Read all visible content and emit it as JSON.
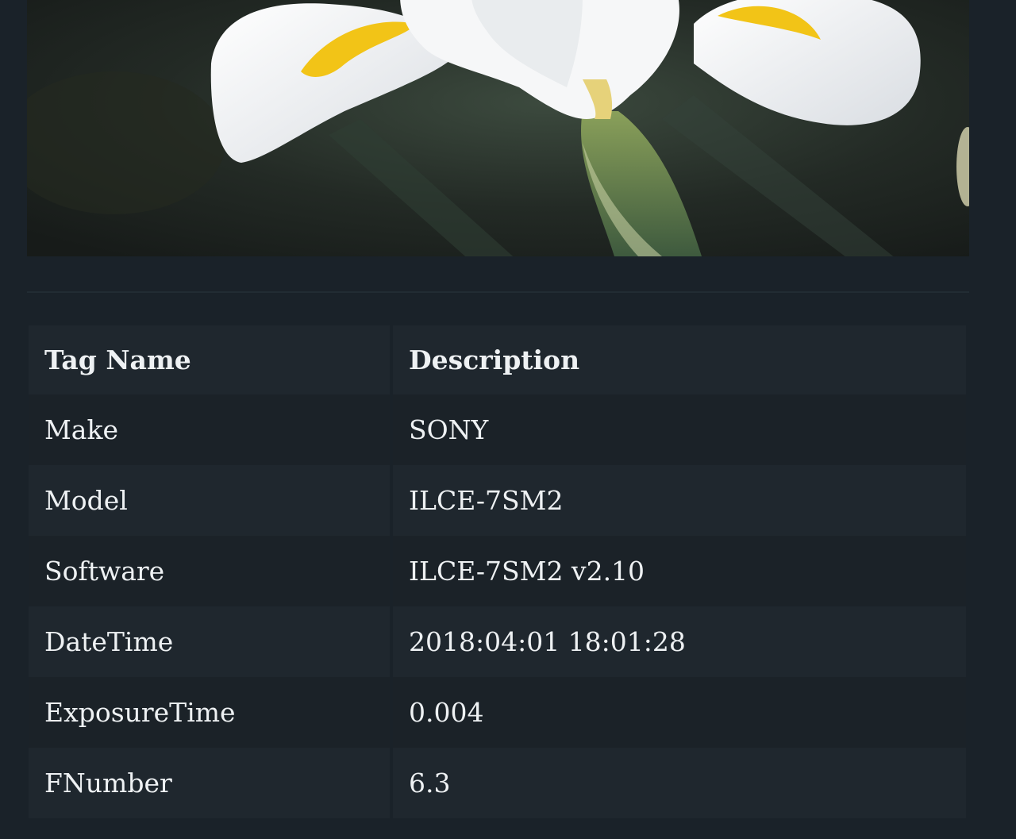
{
  "photo": {
    "subject": "white-iris-flower"
  },
  "table": {
    "headers": {
      "tag": "Tag Name",
      "description": "Description"
    },
    "rows": [
      {
        "tag": "Make",
        "value": "SONY"
      },
      {
        "tag": "Model",
        "value": "ILCE-7SM2"
      },
      {
        "tag": "Software",
        "value": "ILCE-7SM2 v2.10"
      },
      {
        "tag": "DateTime",
        "value": "2018:04:01 18:01:28"
      },
      {
        "tag": "ExposureTime",
        "value": "0.004"
      },
      {
        "tag": "FNumber",
        "value": "6.3"
      }
    ]
  },
  "colors": {
    "background": "#1a2229",
    "row_light": "#1f272e",
    "row_dark": "#1b2228",
    "text": "#eef1f3",
    "petal": "#f4f6f8",
    "petal_accent": "#f2c417"
  }
}
